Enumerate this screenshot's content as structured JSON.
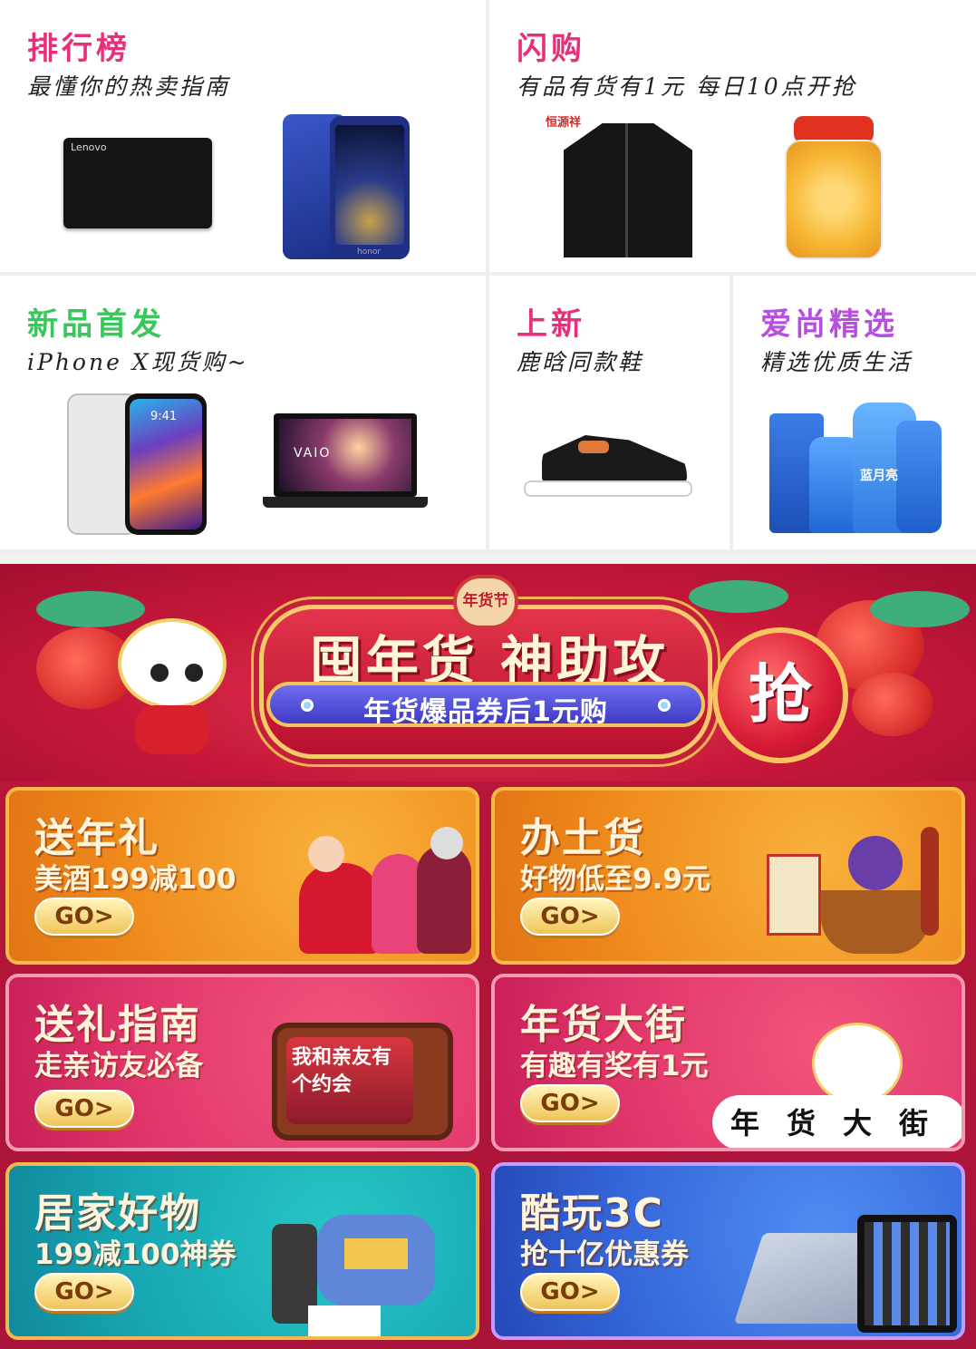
{
  "top_grid": {
    "cells": [
      {
        "title": "排行榜",
        "subtitle": "最懂你的热卖指南",
        "title_color": "#e8307a",
        "products": [
          "Lenovo",
          "honor"
        ]
      },
      {
        "title": "闪购",
        "subtitle": "有品有货有1元 每日10点开抢",
        "title_color": "#e8307a",
        "products": [
          "恒源祥",
          "jacket"
        ]
      },
      {
        "title": "新品首发",
        "subtitle": "iPhone X现货购~",
        "title_color": "#37c75a",
        "products": [
          "9:41",
          "VAIO"
        ]
      },
      {
        "title": "上新",
        "subtitle": "鹿晗同款鞋",
        "title_color": "#e8307a",
        "products": [
          "sneaker"
        ]
      },
      {
        "title": "爱尚精选",
        "subtitle": "精选优质生活",
        "title_color": "#b64ee0",
        "products": [
          "蓝月亮"
        ]
      }
    ]
  },
  "banner": {
    "badge": "年货节",
    "title": "囤年货 神助攻",
    "pill": "年货爆品券后1元购",
    "grab_button": "抢",
    "cards": [
      {
        "title": "送年礼",
        "subtitle": "美酒199减100",
        "go": "GO>",
        "theme": "orange"
      },
      {
        "title": "办土货",
        "subtitle": "好物低至9.9元",
        "go": "GO>",
        "theme": "orange"
      },
      {
        "title": "送礼指南",
        "subtitle": "走亲访友必备",
        "go": "GO>",
        "theme": "pink",
        "art_text": "我和亲友有个约会"
      },
      {
        "title": "年货大街",
        "subtitle": "有趣有奖有1元",
        "go": "GO>",
        "theme": "pink",
        "art_text": "年货大街"
      },
      {
        "title": "居家好物",
        "subtitle": "199减100神券",
        "go": "GO>",
        "theme": "teal"
      },
      {
        "title": "酷玩3C",
        "subtitle": "抢十亿优惠券",
        "go": "GO>",
        "theme": "blue"
      }
    ]
  }
}
